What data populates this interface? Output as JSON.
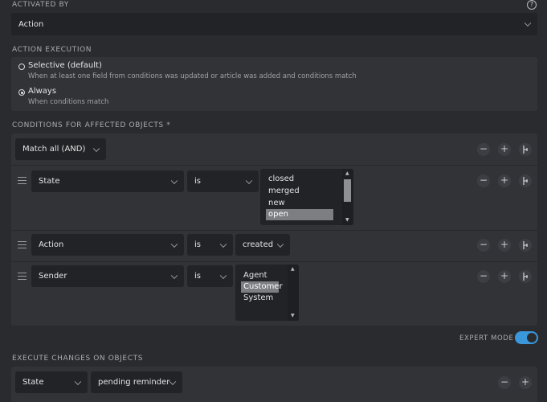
{
  "activated_by": {
    "label": "ACTIVATED BY",
    "help": "?",
    "value": "Action"
  },
  "action_execution": {
    "label": "ACTION EXECUTION",
    "options": [
      {
        "title": "Selective (default)",
        "description": "When at least one field from conditions was updated or article was added and conditions match",
        "selected": false
      },
      {
        "title": "Always",
        "description": "When conditions match",
        "selected": true
      }
    ]
  },
  "conditions": {
    "label": "CONDITIONS FOR AFFECTED OBJECTS *",
    "match_operator": "Match all (AND)",
    "rows": [
      {
        "attribute": "State",
        "operator": "is",
        "options": [
          "closed",
          "merged",
          "new",
          "open"
        ],
        "selected": "open"
      },
      {
        "attribute": "Action",
        "operator": "is",
        "value": "created"
      },
      {
        "attribute": "Sender",
        "operator": "is",
        "options": [
          "Agent",
          "Customer",
          "System"
        ],
        "selected": "Customer"
      }
    ]
  },
  "controls": {
    "remove": "−",
    "add": "+"
  },
  "expert_mode": {
    "label": "EXPERT MODE",
    "enabled": true,
    "color": "#3a97d9"
  },
  "execute_changes": {
    "label": "EXECUTE CHANGES ON OBJECTS",
    "attribute": "State",
    "value": "pending reminder"
  }
}
